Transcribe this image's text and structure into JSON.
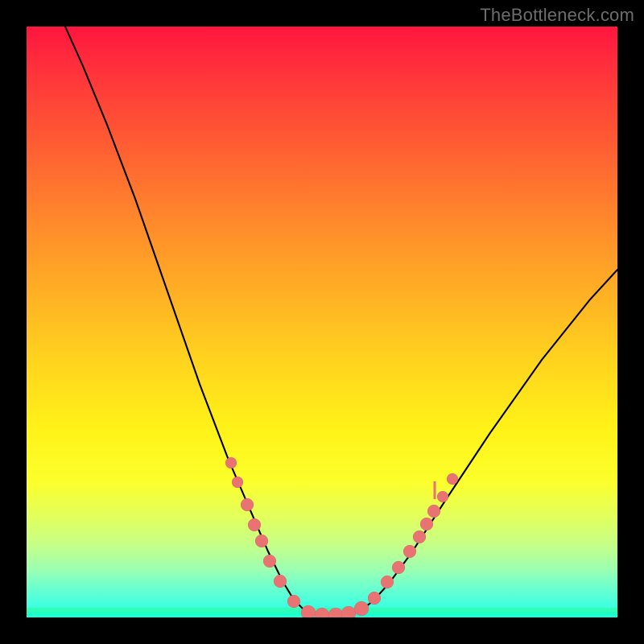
{
  "watermark": "TheBottleneck.com",
  "chart_data": {
    "type": "line",
    "title": "",
    "xlabel": "",
    "ylabel": "",
    "xlim": [
      0,
      734
    ],
    "ylim": [
      0,
      734
    ],
    "grid": false,
    "curve": {
      "left": [
        {
          "x": 48,
          "y": 734
        },
        {
          "x": 70,
          "y": 685
        },
        {
          "x": 100,
          "y": 612
        },
        {
          "x": 135,
          "y": 520
        },
        {
          "x": 175,
          "y": 405
        },
        {
          "x": 215,
          "y": 290
        },
        {
          "x": 250,
          "y": 198
        },
        {
          "x": 278,
          "y": 133
        },
        {
          "x": 300,
          "y": 82
        },
        {
          "x": 318,
          "y": 45
        },
        {
          "x": 332,
          "y": 22
        },
        {
          "x": 345,
          "y": 9
        }
      ],
      "flat": [
        {
          "x": 345,
          "y": 9
        },
        {
          "x": 360,
          "y": 4
        },
        {
          "x": 378,
          "y": 2
        },
        {
          "x": 398,
          "y": 3
        },
        {
          "x": 414,
          "y": 8
        }
      ],
      "right": [
        {
          "x": 414,
          "y": 8
        },
        {
          "x": 430,
          "y": 20
        },
        {
          "x": 450,
          "y": 42
        },
        {
          "x": 478,
          "y": 80
        },
        {
          "x": 520,
          "y": 145
        },
        {
          "x": 575,
          "y": 228
        },
        {
          "x": 640,
          "y": 320
        },
        {
          "x": 700,
          "y": 395
        },
        {
          "x": 734,
          "y": 432
        }
      ]
    },
    "dots": [
      {
        "x": 254,
        "y": 192,
        "r": 7
      },
      {
        "x": 262,
        "y": 168,
        "r": 7
      },
      {
        "x": 274,
        "y": 140,
        "r": 8
      },
      {
        "x": 283,
        "y": 115,
        "r": 8
      },
      {
        "x": 292,
        "y": 95,
        "r": 8
      },
      {
        "x": 302,
        "y": 70,
        "r": 8
      },
      {
        "x": 315,
        "y": 45,
        "r": 8
      },
      {
        "x": 332,
        "y": 20,
        "r": 8
      },
      {
        "x": 350,
        "y": 6,
        "r": 9
      },
      {
        "x": 367,
        "y": 3,
        "r": 9
      },
      {
        "x": 384,
        "y": 3,
        "r": 9
      },
      {
        "x": 400,
        "y": 5,
        "r": 9
      },
      {
        "x": 416,
        "y": 11,
        "r": 9
      },
      {
        "x": 432,
        "y": 24,
        "r": 8
      },
      {
        "x": 448,
        "y": 44,
        "r": 8
      },
      {
        "x": 462,
        "y": 62,
        "r": 8
      },
      {
        "x": 476,
        "y": 82,
        "r": 8
      },
      {
        "x": 488,
        "y": 100,
        "r": 8
      },
      {
        "x": 497,
        "y": 116,
        "r": 8
      },
      {
        "x": 506,
        "y": 132,
        "r": 8
      },
      {
        "x": 517,
        "y": 150,
        "r": 7
      },
      {
        "x": 529,
        "y": 172,
        "r": 7
      }
    ],
    "tick_segment": {
      "x": 507,
      "y1": 147,
      "y2": 169
    }
  }
}
